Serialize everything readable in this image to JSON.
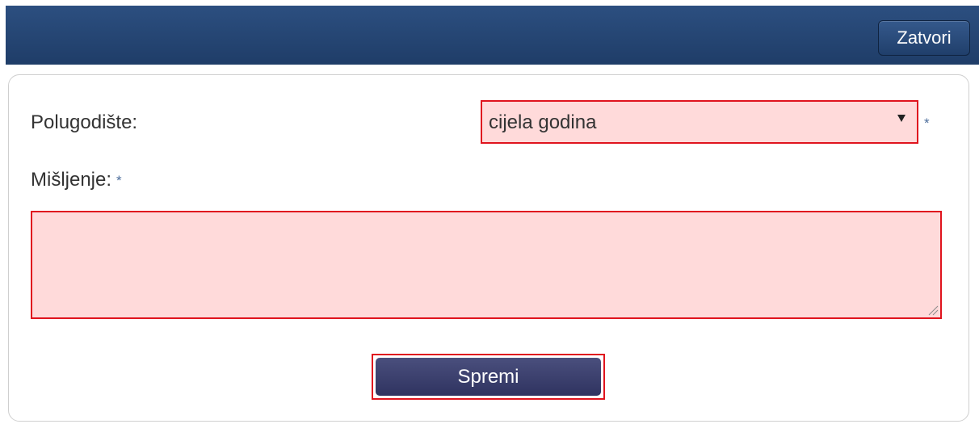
{
  "header": {
    "close_label": "Zatvori"
  },
  "form": {
    "semester_label": "Polugodište:",
    "semester_selected": "cijela godina",
    "opinion_label": "Mišljenje:",
    "opinion_value": "",
    "required_marker": "*",
    "save_label": "Spremi"
  },
  "colors": {
    "header_bg": "#1f3d68",
    "error_border": "#e0141e",
    "error_fill": "#ffdada",
    "required_marker": "#4d6e9c",
    "save_button": "#383c6a"
  },
  "icons": {
    "select_arrow": "chevron-down-icon",
    "resize_handle": "resize-grip-icon",
    "required": "asterisk-icon"
  }
}
